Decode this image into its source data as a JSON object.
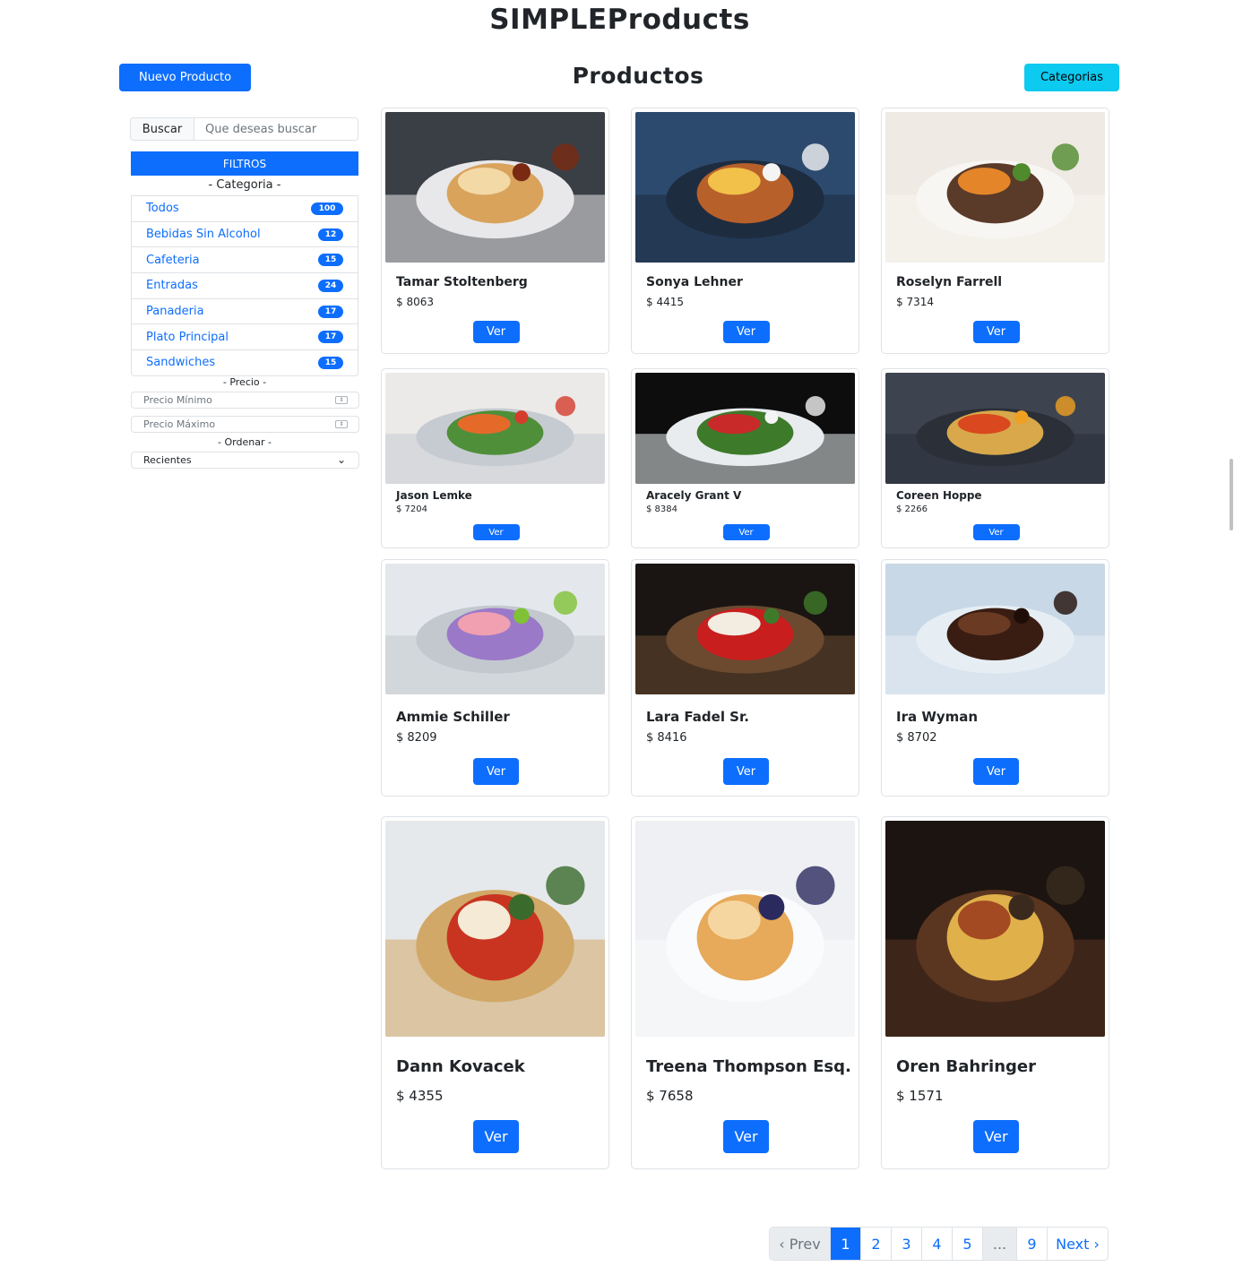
{
  "site_title": "SIMPLEProducts",
  "section_title": "Productos",
  "new_product_label": "Nuevo Producto",
  "categories_label": "Categorias",
  "search": {
    "label": "Buscar",
    "placeholder": "Que deseas buscar"
  },
  "filters": {
    "header": "FILTROS",
    "category_caption": "- Categoria -",
    "categories": [
      {
        "label": "Todos",
        "count": "100"
      },
      {
        "label": "Bebidas Sin Alcohol",
        "count": "12"
      },
      {
        "label": "Cafeteria",
        "count": "15"
      },
      {
        "label": "Entradas",
        "count": "24"
      },
      {
        "label": "Panaderia",
        "count": "17"
      },
      {
        "label": "Plato Principal",
        "count": "17"
      },
      {
        "label": "Sandwiches",
        "count": "15"
      }
    ],
    "price_caption": "- Precio -",
    "min_price_placeholder": "Precio Mínimo",
    "max_price_placeholder": "Precio Máximo",
    "order_caption": "- Ordenar -",
    "order_selected": "Recientes"
  },
  "products": [
    {
      "name": "Tamar Stoltenberg",
      "price": "$ 8063",
      "button": "Ver",
      "image": "pancakes-dessert-photo"
    },
    {
      "name": "Sonya Lehner",
      "price": "$ 4415",
      "button": "Ver",
      "image": "burger-fries-photo"
    },
    {
      "name": "Roselyn Farrell",
      "price": "$ 7314",
      "button": "Ver",
      "image": "lamb-chops-plate-photo"
    },
    {
      "name": "Jason Lemke",
      "price": "$ 7204",
      "button": "Ver",
      "image": "salad-bowl-vegetables-photo"
    },
    {
      "name": "Aracely Grant V",
      "price": "$ 8384",
      "button": "Ver",
      "image": "salad-plate-photo"
    },
    {
      "name": "Coreen Hoppe",
      "price": "$ 2266",
      "button": "Ver",
      "image": "spaghetti-tomatoes-photo"
    },
    {
      "name": "Ammie Schiller",
      "price": "$ 8209",
      "button": "Ver",
      "image": "macarons-photo"
    },
    {
      "name": "Lara Fadel Sr.",
      "price": "$ 8416",
      "button": "Ver",
      "image": "strawberry-parfait-photo"
    },
    {
      "name": "Ira Wyman",
      "price": "$ 8702",
      "button": "Ver",
      "image": "chocolate-cake-photo"
    },
    {
      "name": "Dann Kovacek",
      "price": "$ 4355",
      "button": "Ver",
      "image": "pizzas-photo"
    },
    {
      "name": "Treena Thompson Esq.",
      "price": "$ 7658",
      "button": "Ver",
      "image": "pancake-stack-photo"
    },
    {
      "name": "Oren Bahringer",
      "price": "$ 1571",
      "button": "Ver",
      "image": "burger-board-photo"
    }
  ],
  "pagination": {
    "prev": "‹ Prev",
    "pages": [
      "1",
      "2",
      "3",
      "4",
      "5",
      "...",
      "9"
    ],
    "active": "1",
    "next": "Next ›"
  },
  "colors": {
    "primary": "#0d6efd",
    "info": "#0dcaf0",
    "border": "#dee2e6"
  }
}
